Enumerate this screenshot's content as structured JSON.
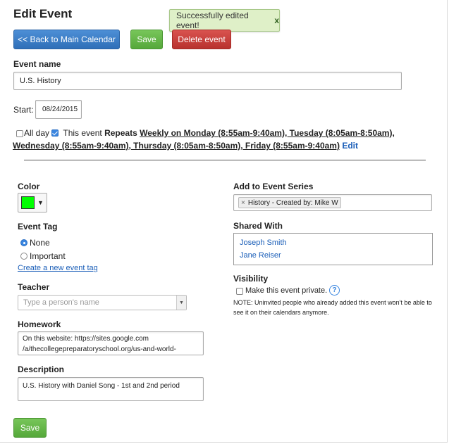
{
  "page_title": "Edit Event",
  "notification": {
    "message": "Successfully edited event!",
    "close": "x"
  },
  "toolbar": {
    "back_label": "<< Back to Main Calendar",
    "save_label": "Save",
    "delete_label": "Delete event"
  },
  "event_name": {
    "label": "Event name",
    "value": "U.S. History"
  },
  "start": {
    "label": "Start:",
    "value": "08/24/2015"
  },
  "all_day": {
    "label": "All day",
    "checked": false
  },
  "repeats": {
    "checked": true,
    "prefix": "This event ",
    "keyword": "Repeats",
    "schedule": "Weekly on Monday (8:55am-9:40am), Tuesday (8:05am-8:50am), Wednesday (8:55am-9:40am), Thursday (8:05am-8:50am), Friday (8:55am-9:40am)",
    "edit_label": "Edit"
  },
  "color": {
    "label": "Color",
    "value": "#00ff00",
    "caret": "▼"
  },
  "event_tag": {
    "label": "Event Tag",
    "options": [
      {
        "label": "None",
        "selected": true
      },
      {
        "label": "Important",
        "selected": false
      }
    ],
    "create_link": "Create a new event tag"
  },
  "teacher": {
    "label": "Teacher",
    "placeholder": "Type a person's name"
  },
  "homework": {
    "label": "Homework",
    "value": "On this website: https://sites.google.com\n/a/thecollegepreparatoryschool.org/us-and-world-"
  },
  "description": {
    "label": "Description",
    "value": "U.S. History with Daniel Song - 1st and 2nd period"
  },
  "event_series": {
    "label": "Add to Event Series",
    "chip": "History - Created by: Mike W",
    "chip_remove": "×"
  },
  "shared_with": {
    "label": "Shared With",
    "people": [
      "Joseph Smith",
      "Jane Reiser"
    ]
  },
  "visibility": {
    "label": "Visibility",
    "private_label": "Make this event private.",
    "private_checked": false,
    "help": "?",
    "note": "NOTE: Uninvited people who already added this event won't be able to see it on their calendars anymore."
  },
  "footer": {
    "save_label": "Save"
  }
}
